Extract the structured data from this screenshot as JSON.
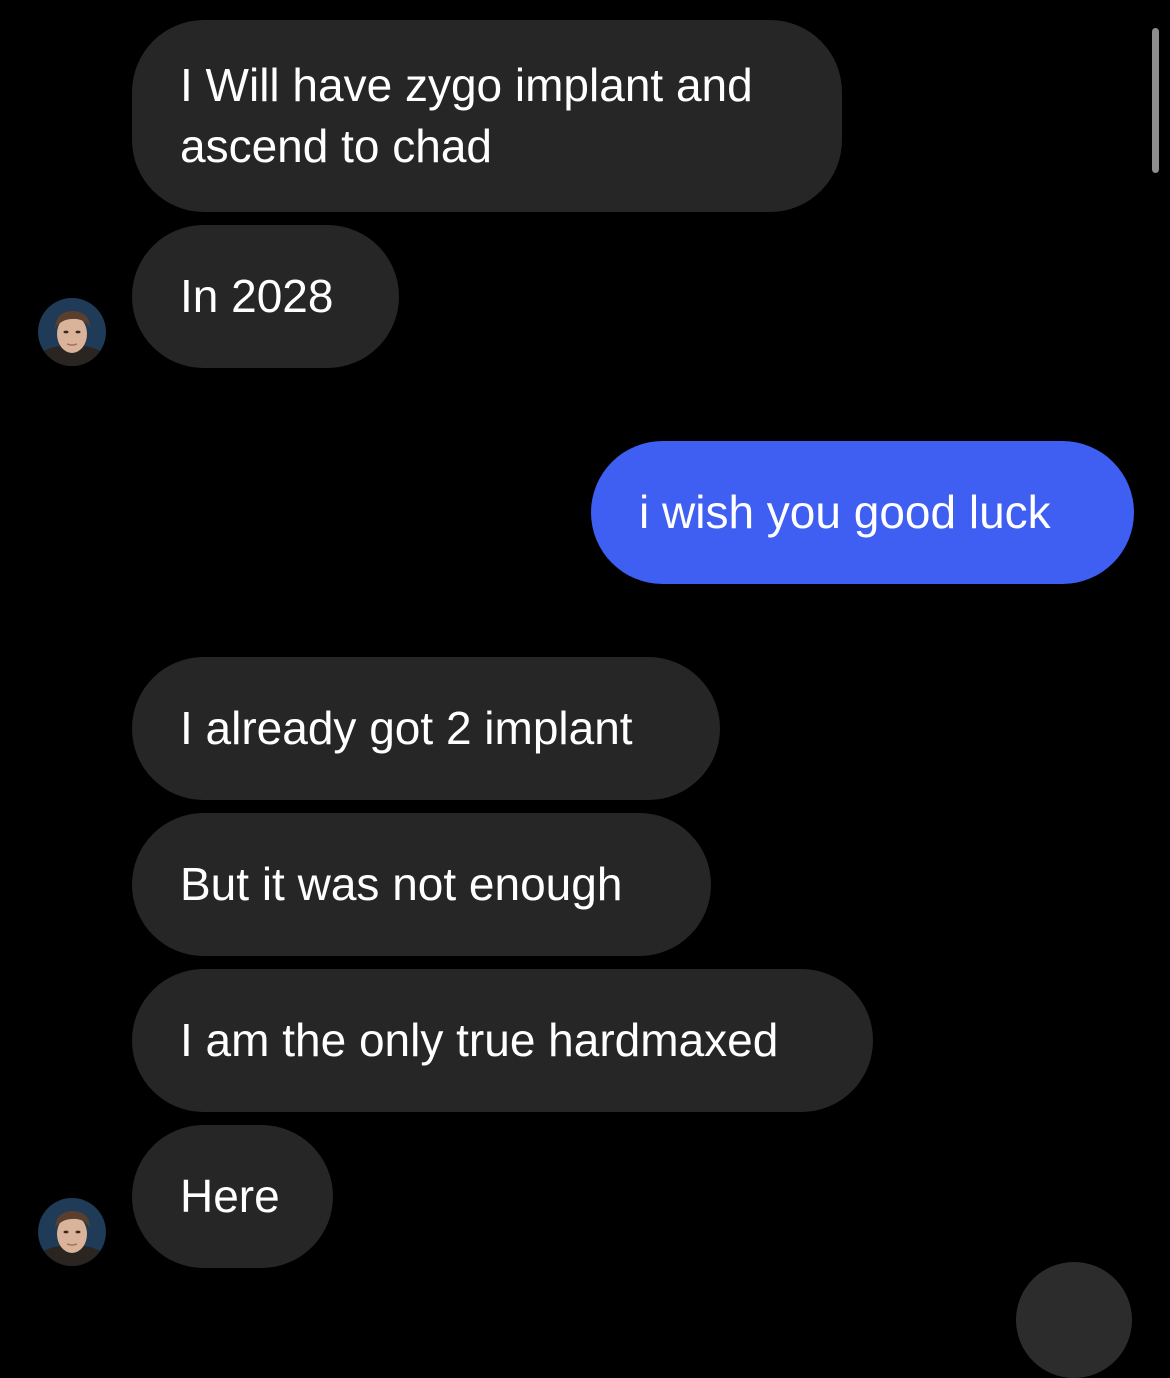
{
  "conversation": {
    "messages": [
      {
        "sender": "other",
        "text": "I Will have zygo implant and ascend to chad"
      },
      {
        "sender": "other",
        "text": "In 2028"
      },
      {
        "sender": "me",
        "text": "i wish you good luck"
      },
      {
        "sender": "other",
        "text": "I already got 2 implant"
      },
      {
        "sender": "other",
        "text": "But it was not enough"
      },
      {
        "sender": "other",
        "text": "I am the only true hardmaxed"
      },
      {
        "sender": "other",
        "text": "Here"
      }
    ]
  },
  "colors": {
    "background": "#000000",
    "incoming_bubble": "#262626",
    "outgoing_bubble": "#3f5ef2",
    "text": "#ffffff"
  },
  "icons": {
    "avatar": "contact-avatar-photo"
  }
}
